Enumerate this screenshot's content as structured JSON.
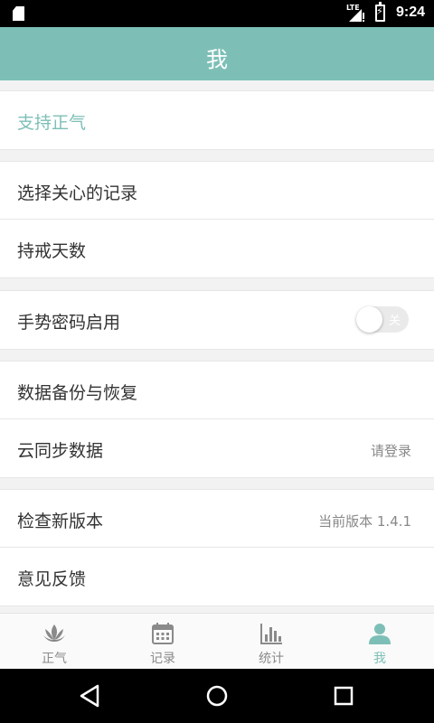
{
  "status_bar": {
    "time": "9:24",
    "network": "LTE"
  },
  "header": {
    "title": "我"
  },
  "groups": [
    {
      "items": [
        {
          "label": "支持正气"
        }
      ]
    },
    {
      "items": [
        {
          "label": "选择关心的记录"
        },
        {
          "label": "持戒天数"
        }
      ]
    },
    {
      "items": [
        {
          "label": "手势密码启用",
          "toggle_text": "关",
          "toggle_on": false
        }
      ]
    },
    {
      "items": [
        {
          "label": "数据备份与恢复"
        },
        {
          "label": "云同步数据",
          "value": "请登录"
        }
      ]
    },
    {
      "items": [
        {
          "label": "检查新版本",
          "value": "当前版本 1.4.1"
        },
        {
          "label": "意见反馈"
        }
      ]
    }
  ],
  "tabs": [
    {
      "label": "正气",
      "icon": "lotus-icon",
      "active": false
    },
    {
      "label": "记录",
      "icon": "calendar-icon",
      "active": false
    },
    {
      "label": "统计",
      "icon": "bar-chart-icon",
      "active": false
    },
    {
      "label": "我",
      "icon": "person-icon",
      "active": true
    }
  ],
  "colors": {
    "accent": "#7dbfb6",
    "tab_inactive": "#8a8a8a"
  },
  "nav_bar": {
    "icons": [
      "back-icon",
      "home-icon",
      "recents-icon"
    ]
  }
}
